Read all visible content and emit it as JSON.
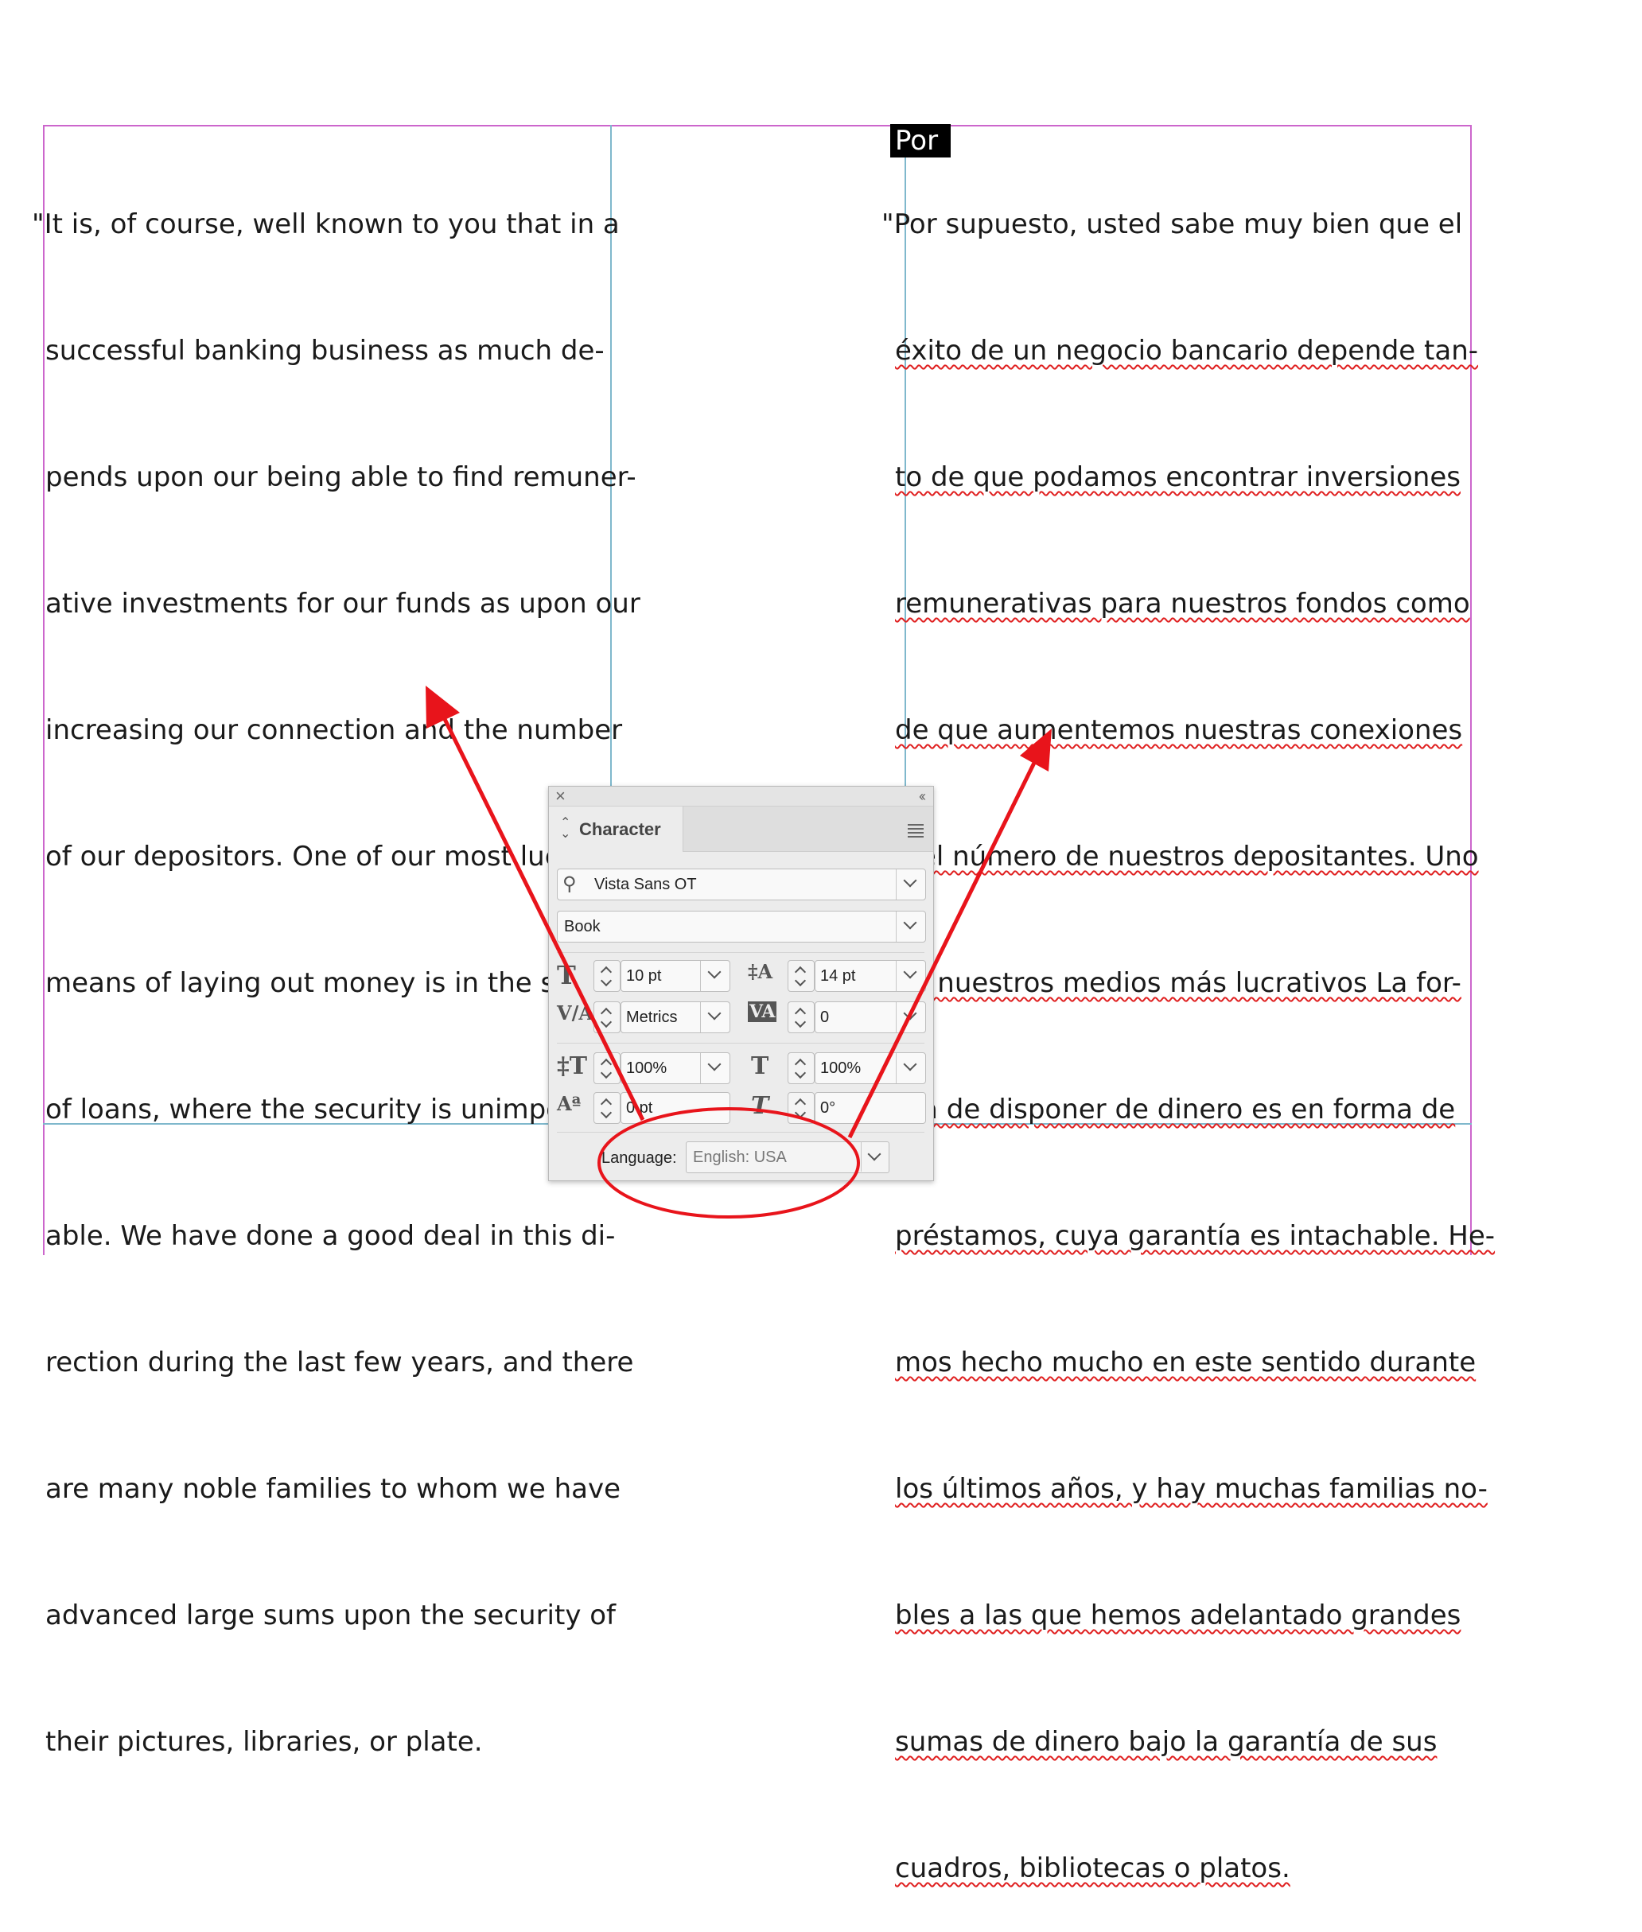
{
  "left_column": {
    "lines": [
      "\"It is, of course, well known to you that in a",
      "successful banking business as much de-",
      "pends upon our being able to find remuner-",
      "ative investments for our funds as upon our",
      "increasing our connection and the number",
      "of our depositors. One of our most lucrative",
      "means of laying out money is in the shape",
      "of loans, where the security is unimpeach-",
      "able. We have done a good deal in this di-",
      "rection during the last few years, and there",
      "are many noble families to whom we have",
      "advanced large sums upon the security of",
      "their pictures, libraries, or plate."
    ]
  },
  "right_column": {
    "lines": [
      "\"Por supuesto, usted sabe muy bien que el",
      "éxito de un negocio bancario depende tan-",
      "to de que podamos encontrar inversiones",
      "remunerativas para nuestros fondos como",
      "de que aumentemos nuestras conexiones",
      "y el número de nuestros depositantes. Uno",
      "de nuestros medios más lucrativos La for-",
      "ma de disponer de dinero es en forma de",
      "préstamos, cuya garantía es intachable. He-",
      "mos hecho mucho en este sentido durante",
      "los últimos años, y hay muchas familias no-",
      "bles a las que hemos adelantado grandes",
      "sumas de dinero bajo la garantía de sus",
      "cuadros, bibliotecas o platos."
    ],
    "selected_word": "Por"
  },
  "character_panel": {
    "tab_label": "Character",
    "font_family": "Vista Sans OT",
    "font_style": "Book",
    "font_size": "10 pt",
    "leading": "14 pt",
    "kerning": "Metrics",
    "tracking": "0",
    "vertical_scale": "100%",
    "horizontal_scale": "100%",
    "baseline_shift": "0 pt",
    "skew": "0°",
    "language_label": "Language:",
    "language_value": "English: USA"
  },
  "annotation": {
    "color": "#e8141b"
  }
}
